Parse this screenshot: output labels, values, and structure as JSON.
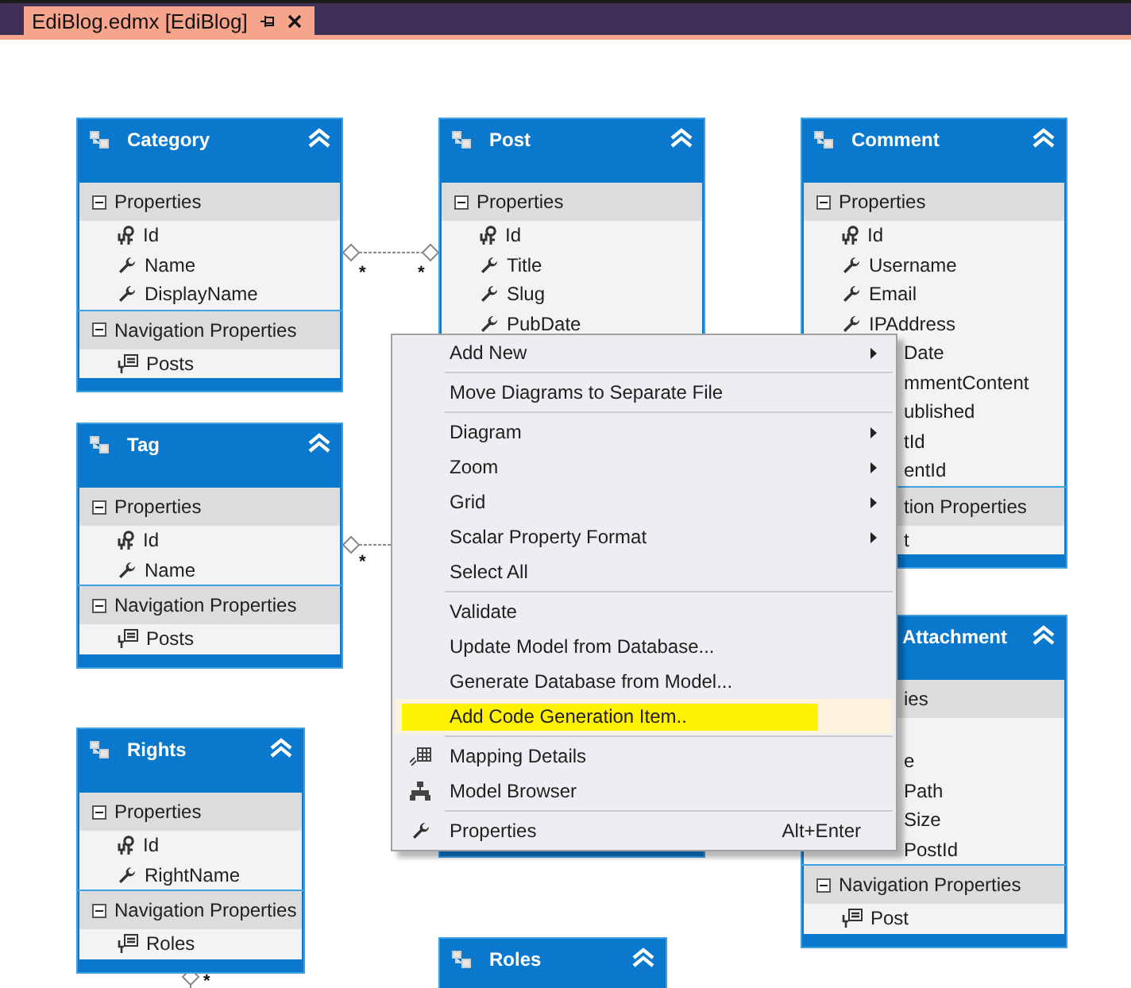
{
  "tab": {
    "title": "EdiBlog.edmx [EdiBlog]"
  },
  "entities": [
    {
      "name": "Category",
      "sections": [
        {
          "title": "Properties",
          "expanded": true,
          "rows": [
            {
              "kind": "key",
              "name": "Id"
            },
            {
              "kind": "scalar",
              "name": "Name"
            },
            {
              "kind": "scalar",
              "name": "DisplayName"
            }
          ]
        },
        {
          "title": "Navigation Properties",
          "expanded": true,
          "rows": [
            {
              "kind": "navigation",
              "name": "Posts"
            }
          ]
        }
      ]
    },
    {
      "name": "Post",
      "sections": [
        {
          "title": "Properties",
          "expanded": true,
          "rows": [
            {
              "kind": "key",
              "name": "Id"
            },
            {
              "kind": "scalar",
              "name": "Title"
            },
            {
              "kind": "scalar",
              "name": "Slug"
            },
            {
              "kind": "scalar",
              "name": "PubDate"
            }
          ]
        }
      ]
    },
    {
      "name": "Comment",
      "sections": [
        {
          "title": "Properties",
          "expanded": true,
          "rows": [
            {
              "kind": "key",
              "name": "Id"
            },
            {
              "kind": "scalar",
              "name": "Username"
            },
            {
              "kind": "scalar",
              "name": "Email"
            },
            {
              "kind": "scalar",
              "name": "IPAddress"
            },
            {
              "name": "Date"
            },
            {
              "name": "mmentContent"
            },
            {
              "name": "ublished"
            },
            {
              "name": "tId"
            },
            {
              "name": "entId"
            }
          ]
        },
        {
          "title": "tion Properties",
          "expanded": true,
          "rows": [
            {
              "name": "t"
            }
          ]
        }
      ]
    },
    {
      "name": "Tag",
      "sections": [
        {
          "title": "Properties",
          "expanded": true,
          "rows": [
            {
              "kind": "key",
              "name": "Id"
            },
            {
              "kind": "scalar",
              "name": "Name"
            }
          ]
        },
        {
          "title": "Navigation Properties",
          "expanded": true,
          "rows": [
            {
              "kind": "navigation",
              "name": "Posts"
            }
          ]
        }
      ]
    },
    {
      "name": "Attachment",
      "sections": [
        {
          "title": "ies",
          "expanded": true,
          "rows": [
            {
              "name": "e"
            },
            {
              "name": "Path"
            },
            {
              "name": "Size"
            },
            {
              "name": "PostId"
            }
          ]
        },
        {
          "title": "Navigation Properties",
          "expanded": true,
          "rows": [
            {
              "kind": "navigation",
              "name": "Post"
            }
          ]
        }
      ]
    },
    {
      "name": "Rights",
      "sections": [
        {
          "title": "Properties",
          "expanded": true,
          "rows": [
            {
              "kind": "key",
              "name": "Id"
            },
            {
              "kind": "scalar",
              "name": "RightName"
            }
          ]
        },
        {
          "title": "Navigation Properties",
          "expanded": true,
          "rows": [
            {
              "kind": "navigation",
              "name": "Roles"
            }
          ]
        }
      ]
    },
    {
      "name": "Roles"
    }
  ],
  "associations": [
    {
      "labels": [
        "*",
        "*"
      ]
    },
    {
      "labels": [
        "*"
      ]
    },
    {
      "labels": [
        "*"
      ]
    }
  ],
  "menu": {
    "items": [
      {
        "kind": "submenu",
        "label": "Add New",
        "highlighted": false,
        "marked": false
      },
      {
        "kind": "separator"
      },
      {
        "kind": "item",
        "label": "Move Diagrams to Separate File",
        "highlighted": false,
        "marked": false
      },
      {
        "kind": "separator"
      },
      {
        "kind": "submenu",
        "label": "Diagram",
        "highlighted": false,
        "marked": false
      },
      {
        "kind": "submenu",
        "label": "Zoom",
        "highlighted": false,
        "marked": false
      },
      {
        "kind": "submenu",
        "label": "Grid",
        "highlighted": false,
        "marked": false
      },
      {
        "kind": "submenu",
        "label": "Scalar Property Format",
        "highlighted": false,
        "marked": false
      },
      {
        "kind": "item",
        "label": "Select All",
        "highlighted": false,
        "marked": false
      },
      {
        "kind": "separator"
      },
      {
        "kind": "item",
        "label": "Validate",
        "highlighted": false,
        "marked": false
      },
      {
        "kind": "item",
        "label": "Update Model from Database...",
        "highlighted": false,
        "marked": false
      },
      {
        "kind": "item",
        "label": "Generate Database from Model...",
        "highlighted": false,
        "marked": false
      },
      {
        "kind": "item",
        "label": "Add Code Generation Item..",
        "highlighted": true,
        "marked": true
      },
      {
        "kind": "separator"
      },
      {
        "kind": "item",
        "label": "Mapping Details",
        "highlighted": false,
        "marked": false
      },
      {
        "kind": "item",
        "label": "Model Browser",
        "highlighted": false,
        "marked": false
      },
      {
        "kind": "separator"
      },
      {
        "kind": "item",
        "label": "Properties",
        "highlighted": false,
        "marked": false,
        "shortcut": "Alt+Enter"
      }
    ]
  }
}
